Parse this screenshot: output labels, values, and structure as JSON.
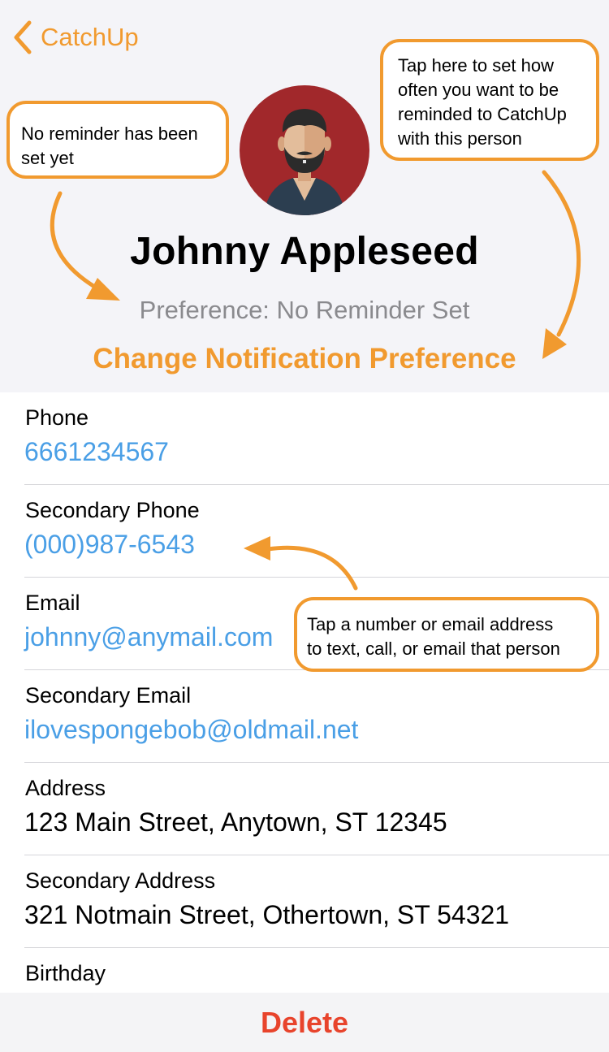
{
  "nav": {
    "back_label": "CatchUp"
  },
  "contact": {
    "name": "Johnny Appleseed",
    "preference": "Preference: No Reminder Set",
    "change_preference_label": "Change Notification Preference"
  },
  "callouts": {
    "no_reminder": {
      "line1": "No reminder has been",
      "line2": "set yet"
    },
    "tap_preference": {
      "line1": "Tap here to set how",
      "line2": "often you want to be",
      "line3": "reminded to CatchUp",
      "line4": "with this person"
    },
    "tap_contact": {
      "line1": "Tap a number or email address",
      "line2": "to text, call, or email that person"
    }
  },
  "fields": [
    {
      "label": "Phone",
      "value": "6661234567"
    },
    {
      "label": "Secondary Phone",
      "value": "(000)987-6543"
    },
    {
      "label": "Email",
      "value": "johnny@anymail.com"
    },
    {
      "label": "Secondary Email",
      "value": "ilovespongebob@oldmail.net"
    },
    {
      "label": "Address",
      "value": "123 Main Street, Anytown, ST 12345"
    },
    {
      "label": "Secondary Address",
      "value": "321 Notmain Street, Othertown, ST 54321"
    },
    {
      "label": "Birthday",
      "value": ""
    }
  ],
  "toolbar": {
    "delete_label": "Delete"
  },
  "colors": {
    "accent": "#f19a2f",
    "link": "#4a9fe6",
    "destructive": "#e8442c",
    "avatar_background": "#a1282b",
    "header_background": "#f4f4f8"
  }
}
